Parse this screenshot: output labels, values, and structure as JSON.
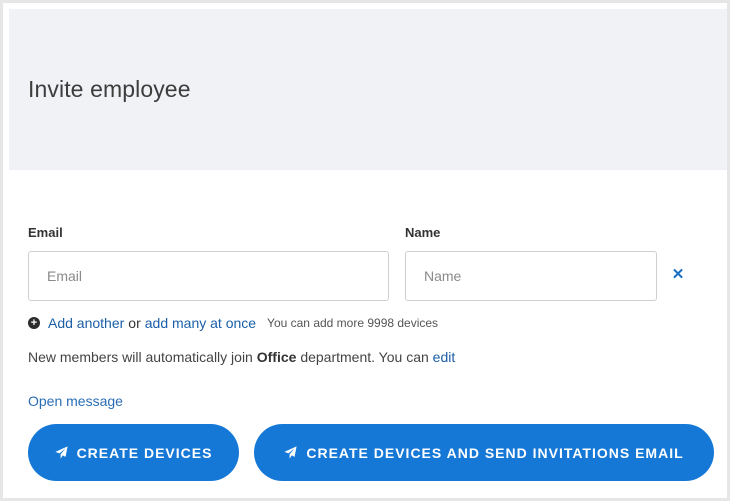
{
  "header": {
    "title": "Invite employee"
  },
  "form": {
    "email": {
      "label": "Email",
      "placeholder": "Email",
      "value": ""
    },
    "name": {
      "label": "Name",
      "placeholder": "Name",
      "value": ""
    },
    "remove_icon": "close-icon"
  },
  "add_row": {
    "icon": "plus-circle-icon",
    "add_another": "Add another",
    "or": "or",
    "add_many": "add many at once",
    "hint": "You can add more 9998 devices"
  },
  "department_note": {
    "prefix": "New members will automatically join",
    "department": "Office",
    "suffix": "department. You can",
    "edit_link": "edit"
  },
  "open_message": "Open message",
  "actions": {
    "create_devices": "CREATE DEVICES",
    "create_and_send": "CREATE DEVICES AND SEND INVITATIONS EMAIL",
    "icon": "paper-plane-icon"
  },
  "colors": {
    "primary": "#1578d6",
    "link": "#1a5fa8",
    "header_bg": "#f1f2f5",
    "frame_border": "#e6e6e6"
  }
}
